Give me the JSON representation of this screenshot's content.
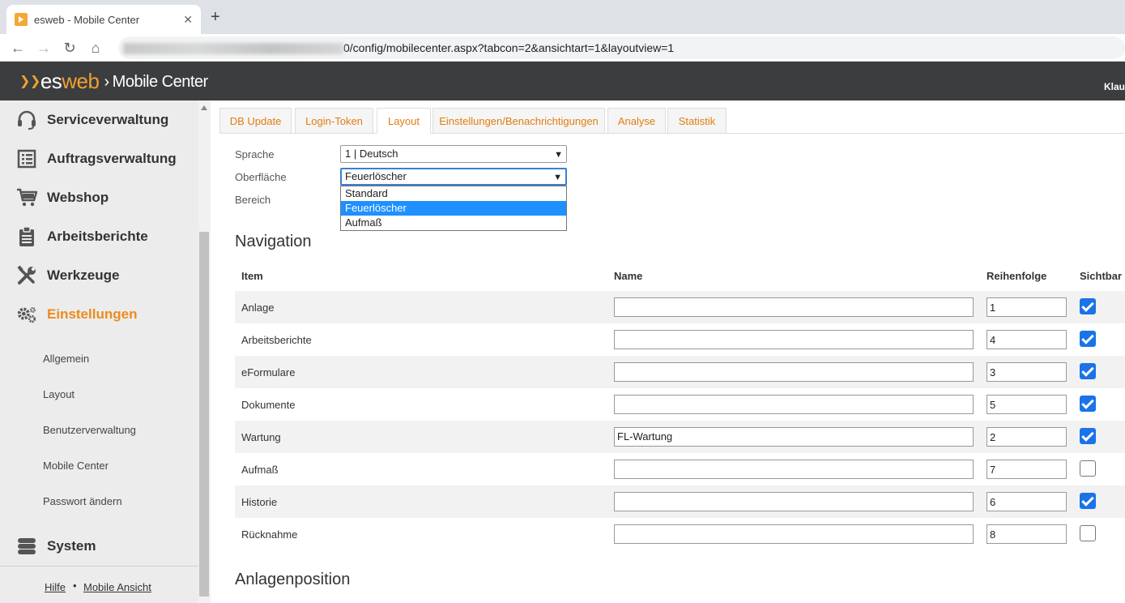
{
  "browser": {
    "tab_title": "esweb - Mobile Center",
    "close_glyph": "✕",
    "new_tab_glyph": "+",
    "url_suffix": "0/config/mobilecenter.aspx?tabcon=2&ansichtart=1&layoutview=1"
  },
  "header": {
    "logo_es": "es",
    "logo_web": "web",
    "separator": "›",
    "app_title": "Mobile Center",
    "user": "Klau"
  },
  "sidebar": {
    "items": [
      {
        "label": "Serviceverwaltung",
        "icon": "headset-icon"
      },
      {
        "label": "Auftragsverwaltung",
        "icon": "list-icon"
      },
      {
        "label": "Webshop",
        "icon": "cart-icon"
      },
      {
        "label": "Arbeitsberichte",
        "icon": "clipboard-icon"
      },
      {
        "label": "Werkzeuge",
        "icon": "tools-icon"
      },
      {
        "label": "Einstellungen",
        "icon": "gears-icon",
        "active": true
      }
    ],
    "sub_items": [
      "Allgemein",
      "Layout",
      "Benutzerverwaltung",
      "Mobile Center",
      "Passwort ändern"
    ],
    "system": {
      "label": "System",
      "icon": "database-icon"
    },
    "footer": {
      "help": "Hilfe",
      "separator": "•",
      "mobile": "Mobile Ansicht"
    }
  },
  "tabs": [
    "DB Update",
    "Login-Token",
    "Layout",
    "Einstellungen/Benachrichtigungen",
    "Analyse",
    "Statistik"
  ],
  "active_tab": "Layout",
  "form": {
    "sprache_label": "Sprache",
    "sprache_value": "1 | Deutsch",
    "oberflaeche_label": "Oberfläche",
    "oberflaeche_value": "Feuerlöscher",
    "bereich_label": "Bereich",
    "dropdown_options": [
      "Standard",
      "Feuerlöscher",
      "Aufmaß"
    ],
    "dropdown_selected": "Feuerlöscher"
  },
  "navigation": {
    "title": "Navigation",
    "headers": {
      "item": "Item",
      "name": "Name",
      "order": "Reihenfolge",
      "visible": "Sichtbar"
    },
    "rows": [
      {
        "item": "Anlage",
        "name": "",
        "order": "1",
        "visible": true
      },
      {
        "item": "Arbeitsberichte",
        "name": "",
        "order": "4",
        "visible": true
      },
      {
        "item": "eFormulare",
        "name": "",
        "order": "3",
        "visible": true
      },
      {
        "item": "Dokumente",
        "name": "",
        "order": "5",
        "visible": true
      },
      {
        "item": "Wartung",
        "name": "FL-Wartung",
        "order": "2",
        "visible": true
      },
      {
        "item": "Aufmaß",
        "name": "",
        "order": "7",
        "visible": false
      },
      {
        "item": "Historie",
        "name": "",
        "order": "6",
        "visible": true
      },
      {
        "item": "Rücknahme",
        "name": "",
        "order": "8",
        "visible": false
      }
    ]
  },
  "anlagenposition": {
    "title": "Anlagenposition"
  },
  "colors": {
    "accent": "#f08a1c",
    "header_bg": "#3b3d3e",
    "checkbox": "#1a73e8"
  }
}
